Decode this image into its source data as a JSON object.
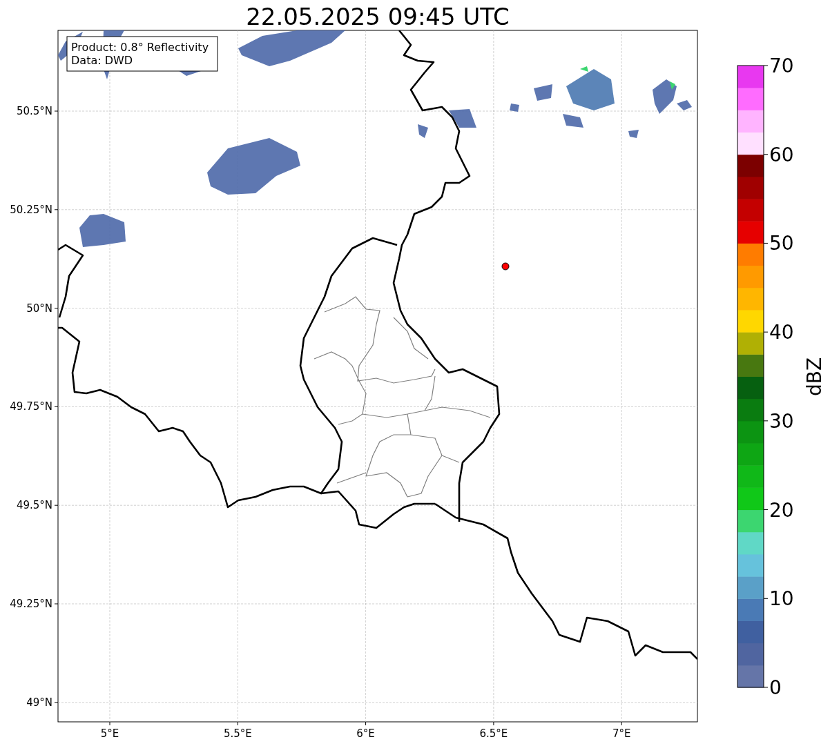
{
  "title": "22.05.2025 09:45 UTC",
  "info_box": {
    "lines": [
      "Product: 0.8° Reflectivity",
      "Data: DWD"
    ]
  },
  "x_ticks": [
    "5°E",
    "5.5°E",
    "6°E",
    "6.5°E",
    "7°E"
  ],
  "y_ticks": [
    "50.5°N",
    "50.25°N",
    "50°N",
    "49.75°N",
    "49.5°N",
    "49.25°N",
    "49°N"
  ],
  "colorbar": {
    "label": "dBZ",
    "ticks": [
      "70",
      "60",
      "50",
      "40",
      "30",
      "20",
      "10",
      "0"
    ],
    "bins": [
      {
        "color": "#6575a8"
      },
      {
        "color": "#5065a0"
      },
      {
        "color": "#4060a0"
      },
      {
        "color": "#4a7ab5"
      },
      {
        "color": "#5aa0c8"
      },
      {
        "color": "#66c2dc"
      },
      {
        "color": "#60d8c6"
      },
      {
        "color": "#3cd670"
      },
      {
        "color": "#10c818"
      },
      {
        "color": "#10b818"
      },
      {
        "color": "#0ea614"
      },
      {
        "color": "#0c9412"
      },
      {
        "color": "#0a7c10"
      },
      {
        "color": "#066010"
      },
      {
        "color": "#487810"
      },
      {
        "color": "#b0b004"
      },
      {
        "color": "#ffd700"
      },
      {
        "color": "#ffb600"
      },
      {
        "color": "#ff9a00"
      },
      {
        "color": "#ff7c00"
      },
      {
        "color": "#e60000"
      },
      {
        "color": "#c40000"
      },
      {
        "color": "#a00000"
      },
      {
        "color": "#7c0000"
      },
      {
        "color": "#ffe0ff"
      },
      {
        "color": "#ffb4ff"
      },
      {
        "color": "#ff6cff"
      },
      {
        "color": "#e838f0"
      }
    ]
  }
}
